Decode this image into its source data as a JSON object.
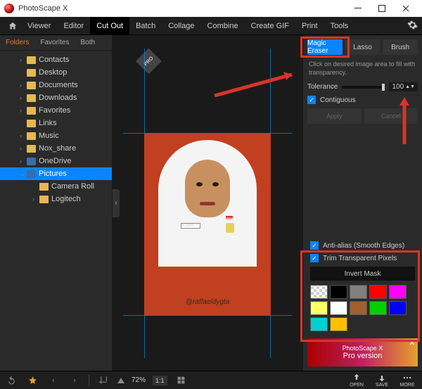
{
  "app": {
    "title": "PhotoScape X"
  },
  "menu": {
    "items": [
      "Viewer",
      "Editor",
      "Cut Out",
      "Batch",
      "Collage",
      "Combine",
      "Create GIF",
      "Print",
      "Tools"
    ],
    "active": "Cut Out"
  },
  "sidebar": {
    "tabs": [
      "Folders",
      "Favorites",
      "Both"
    ],
    "active": "Folders",
    "tree": [
      {
        "label": "Contacts",
        "depth": 2,
        "exp": "›"
      },
      {
        "label": "Desktop",
        "depth": 2,
        "exp": " "
      },
      {
        "label": "Documents",
        "depth": 2,
        "exp": "›"
      },
      {
        "label": "Downloads",
        "depth": 2,
        "exp": "›"
      },
      {
        "label": "Favorites",
        "depth": 2,
        "exp": "›"
      },
      {
        "label": "Links",
        "depth": 2,
        "exp": " "
      },
      {
        "label": "Music",
        "depth": 2,
        "exp": "›"
      },
      {
        "label": "Nox_share",
        "depth": 2,
        "exp": "›"
      },
      {
        "label": "OneDrive",
        "depth": 2,
        "exp": "›",
        "icon": "spec"
      },
      {
        "label": "Pictures",
        "depth": 2,
        "exp": "⌄",
        "sel": true,
        "icon": "spec"
      },
      {
        "label": "Camera Roll",
        "depth": 3,
        "exp": " "
      },
      {
        "label": "Logitech",
        "depth": 3,
        "exp": "›"
      }
    ]
  },
  "canvas": {
    "pro": "PRO",
    "watermark": "@raffaeldygta",
    "name_tag": "SUSAN"
  },
  "tools": {
    "tabs": [
      "Magic Eraser",
      "Lasso",
      "Brush"
    ],
    "active": "Magic Eraser",
    "hint": "Click on desired image area to fill with transparency.",
    "tolerance_label": "Tolerance",
    "tolerance_value": "100",
    "contiguous_label": "Contiguous",
    "apply": "Apply",
    "cancel": "Cancel",
    "antialias": "Anti-alias (Smooth Edges)",
    "trim": "Trim Transparent Pixels",
    "invert": "Invert Mask",
    "swatches": [
      "#dcdcdc",
      "#000000",
      "#808080",
      "#ff0000",
      "#ff00ff",
      "#ffff66",
      "#ffffff",
      "#a06030",
      "#00d000",
      "#0000ff",
      "#00d0d0",
      "#ffc000"
    ]
  },
  "promo": {
    "line1": "PhotoScape X",
    "line2": "Pro version",
    "close": "✕"
  },
  "footer": {
    "zoom": "72%",
    "ratio": "1:1",
    "open": "OPEN",
    "save": "SAVE",
    "more": "MORE"
  }
}
